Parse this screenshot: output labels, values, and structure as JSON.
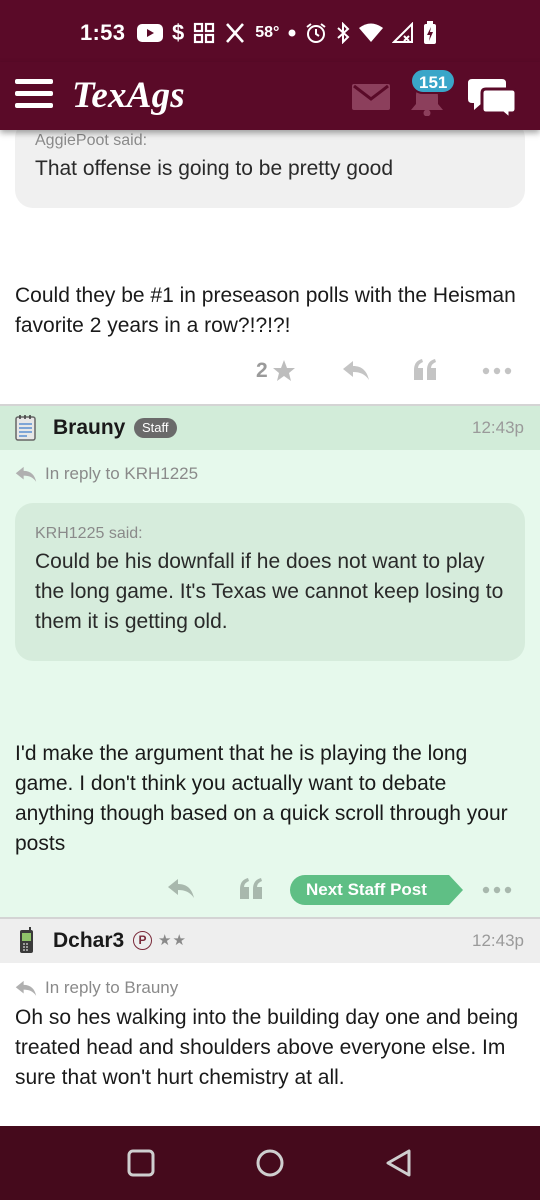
{
  "status_bar": {
    "time": "1:53",
    "temperature": "58°",
    "icons": [
      "youtube-icon",
      "dollar-icon",
      "grid-icon",
      "x-icon",
      "dot-icon",
      "alarm-icon",
      "bluetooth-icon",
      "wifi-icon",
      "signal-icon",
      "battery-icon"
    ]
  },
  "app_header": {
    "logo": "TexAgs",
    "notification_count": "151"
  },
  "post1": {
    "quote_attribution": "AggiePoot said:",
    "quote_text": "That offense is going to be pretty good",
    "body": "Could they be #1 in preseason polls with the Heisman favorite 2 years in a row?!?!?!",
    "like_count": "2"
  },
  "post2": {
    "username": "Brauny",
    "badge": "Staff",
    "time": "12:43p",
    "reply_to": "In reply to KRH1225",
    "quote_attribution": "KRH1225 said:",
    "quote_text": "Could be his downfall if he does not want to play the long game. It's Texas we cannot keep losing to them it is getting old.",
    "body": "I'd make the argument that he is playing the long game. I don't think you actually want to debate anything though based on a quick scroll through your posts",
    "next_staff_label": "Next Staff Post"
  },
  "post3": {
    "username": "Dchar3",
    "premium_badge": "P",
    "stars": "★★",
    "time": "12:43p",
    "reply_to": "In reply to Brauny",
    "body": "Oh so hes walking into the building day one and being treated head and shoulders above everyone else. Im sure that won't hurt chemistry at all."
  },
  "colors": {
    "brand_maroon": "#5a0a28",
    "staff_bg": "#e6f9ec",
    "staff_header_bg": "#d2ecd9",
    "accent_green": "#5fbf85",
    "badge_blue": "#3aa6c9"
  }
}
